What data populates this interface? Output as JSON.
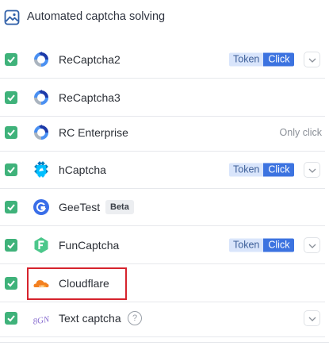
{
  "header": {
    "title": "Automated captcha solving",
    "icon": "image-icon"
  },
  "colors": {
    "check_green": "#3fb27a",
    "token_bg": "#d9e5fb",
    "click_bg": "#3c73e0",
    "highlight_red": "#d6232d"
  },
  "rows": [
    {
      "label": "ReCaptcha2",
      "checked": true,
      "icon": "recaptcha-icon",
      "mode": {
        "token": "Token",
        "click": "Click",
        "selected": "Click"
      },
      "expandable": true
    },
    {
      "label": "ReCaptcha3",
      "checked": true,
      "icon": "recaptcha-icon"
    },
    {
      "label": "RC Enterprise",
      "checked": true,
      "icon": "recaptcha-icon",
      "note": "Only click"
    },
    {
      "label": "hCaptcha",
      "checked": true,
      "icon": "hcaptcha-icon",
      "mode": {
        "token": "Token",
        "click": "Click",
        "selected": "Click"
      },
      "expandable": true
    },
    {
      "label": "GeeTest",
      "checked": true,
      "icon": "geetest-icon",
      "badge": "Beta"
    },
    {
      "label": "FunCaptcha",
      "checked": true,
      "icon": "funcaptcha-icon",
      "mode": {
        "token": "Token",
        "click": "Click",
        "selected": "Click"
      },
      "expandable": true
    },
    {
      "label": "Cloudflare",
      "checked": true,
      "icon": "cloudflare-icon",
      "highlighted": true
    },
    {
      "label": "Text captcha",
      "checked": true,
      "icon": "text-captcha-icon",
      "help": "?",
      "expandable": true
    }
  ]
}
